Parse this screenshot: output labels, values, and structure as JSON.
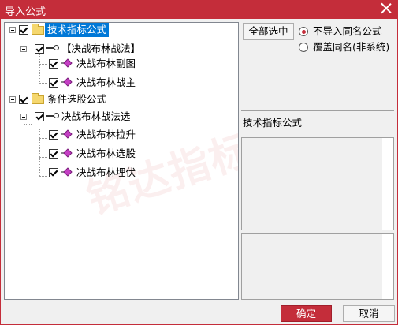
{
  "window": {
    "title": "导入公式"
  },
  "tree": {
    "watermark": "铭达指标",
    "nodes": [
      {
        "label": "技术指标公式",
        "icon": "folder-icon",
        "checked": true,
        "selected": true
      },
      {
        "label": "【决战布林战法】",
        "icon": "key-icon",
        "checked": true
      },
      {
        "label": "决战布林副图",
        "icon": "gem-icon",
        "checked": true
      },
      {
        "label": "决战布林战主",
        "icon": "gem-icon",
        "checked": true
      },
      {
        "label": "条件选股公式",
        "icon": "folder-icon",
        "checked": true
      },
      {
        "label": "决战布林战法选",
        "icon": "key-icon",
        "checked": true
      },
      {
        "label": "决战布林拉升",
        "icon": "gem-icon",
        "checked": true
      },
      {
        "label": "决战布林选股",
        "icon": "gem-icon",
        "checked": true
      },
      {
        "label": "决战布林埋伏",
        "icon": "gem-icon",
        "checked": true
      }
    ]
  },
  "right": {
    "select_all_label": "全部选中",
    "radio_options": [
      {
        "label": "不导入同名公式",
        "selected": true
      },
      {
        "label": "覆盖同名(非系统)",
        "selected": false
      }
    ],
    "section_label": "技术指标公式"
  },
  "footer": {
    "confirm_label": "确定",
    "cancel_label": "取消"
  },
  "colors": {
    "title_bar": "#c42d3a",
    "selection": "#0078d7",
    "confirm_button": "#c42d3a"
  }
}
